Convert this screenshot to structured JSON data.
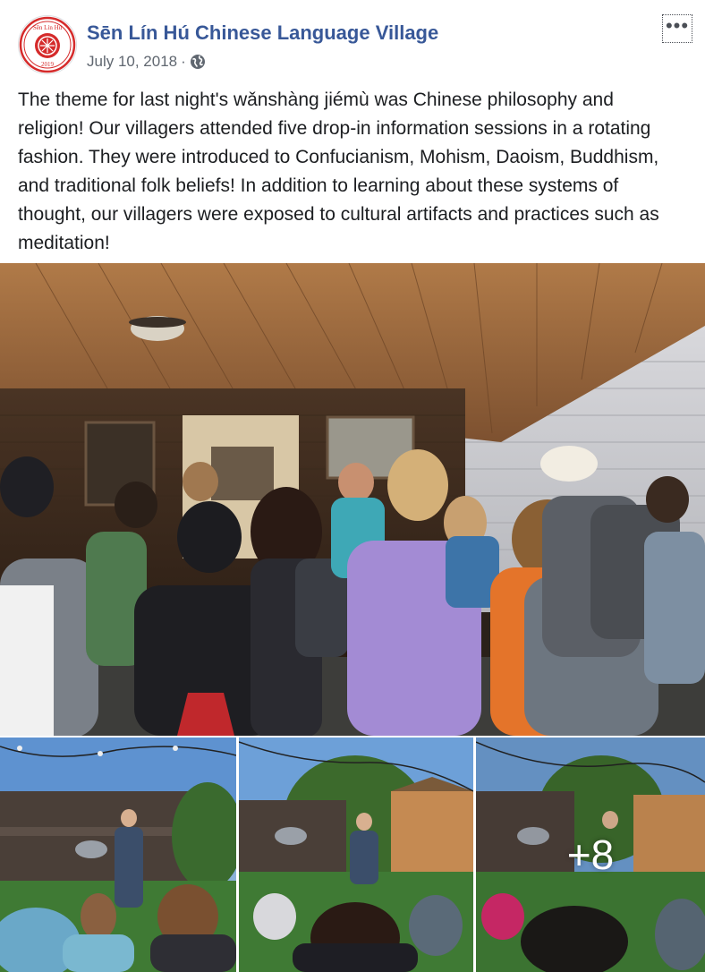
{
  "post": {
    "page_name": "Sēn Lín Hú Chinese Language Village",
    "date": "July 10, 2018",
    "separator": "·",
    "privacy_icon": "globe-icon",
    "more_label": "•••",
    "text": "The theme for last night's wǎnshàng jiémù was Chinese philosophy and religion! Our villagers attended five drop-in information sessions in a rotating fashion. They were introduced to Confucianism, Mohism, Daoism, Buddhism, and traditional folk beliefs! In addition to learning about these systems of thought, our villagers were exposed to cultural artifacts and practices such as meditation!"
  },
  "avatar": {
    "top_text": "Sēn Lín Hú",
    "year": "2019",
    "color": "#d52b2b"
  },
  "photos": {
    "more_count": "+8"
  },
  "colors": {
    "link": "#385898",
    "meta": "#606770",
    "text": "#1c1e21"
  }
}
